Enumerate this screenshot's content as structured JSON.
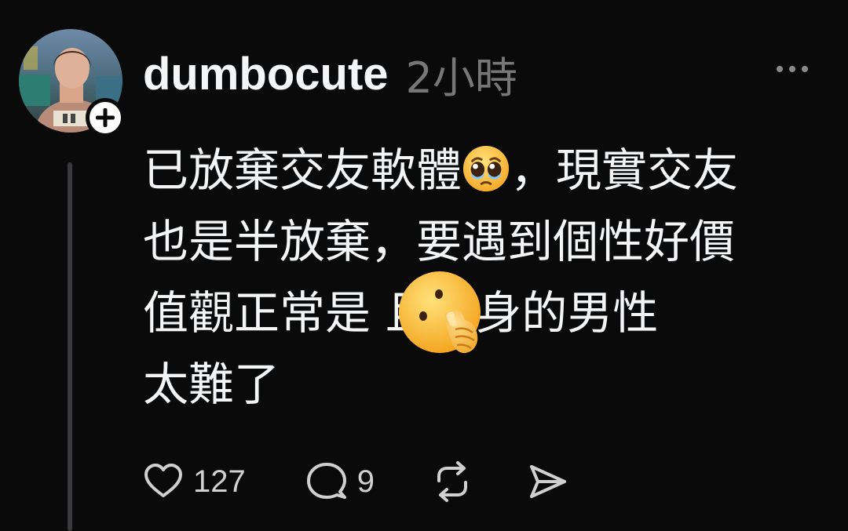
{
  "post": {
    "author": {
      "username": "dumbocute",
      "timestamp": "2小時"
    },
    "text_lines": [
      {
        "before": "已放棄交友軟體",
        "emoji": "pleading-face-emoji",
        "after": "，現實交友"
      },
      {
        "text": "也是半放棄，要遇到個性好價"
      },
      {
        "text": "值觀正常是 且單身的男性"
      },
      {
        "text": "太難了"
      }
    ],
    "overlay_emoji": "shushing-face-emoji"
  },
  "actions": {
    "likes": "127",
    "replies": "9",
    "like_icon": "heart-icon",
    "reply_icon": "comment-icon",
    "repost_icon": "repost-icon",
    "share_icon": "send-icon"
  },
  "colors": {
    "background": "#0a0a0a",
    "text": "#f3f5f7",
    "muted": "#777777",
    "thread_line": "#3a3a3c"
  }
}
